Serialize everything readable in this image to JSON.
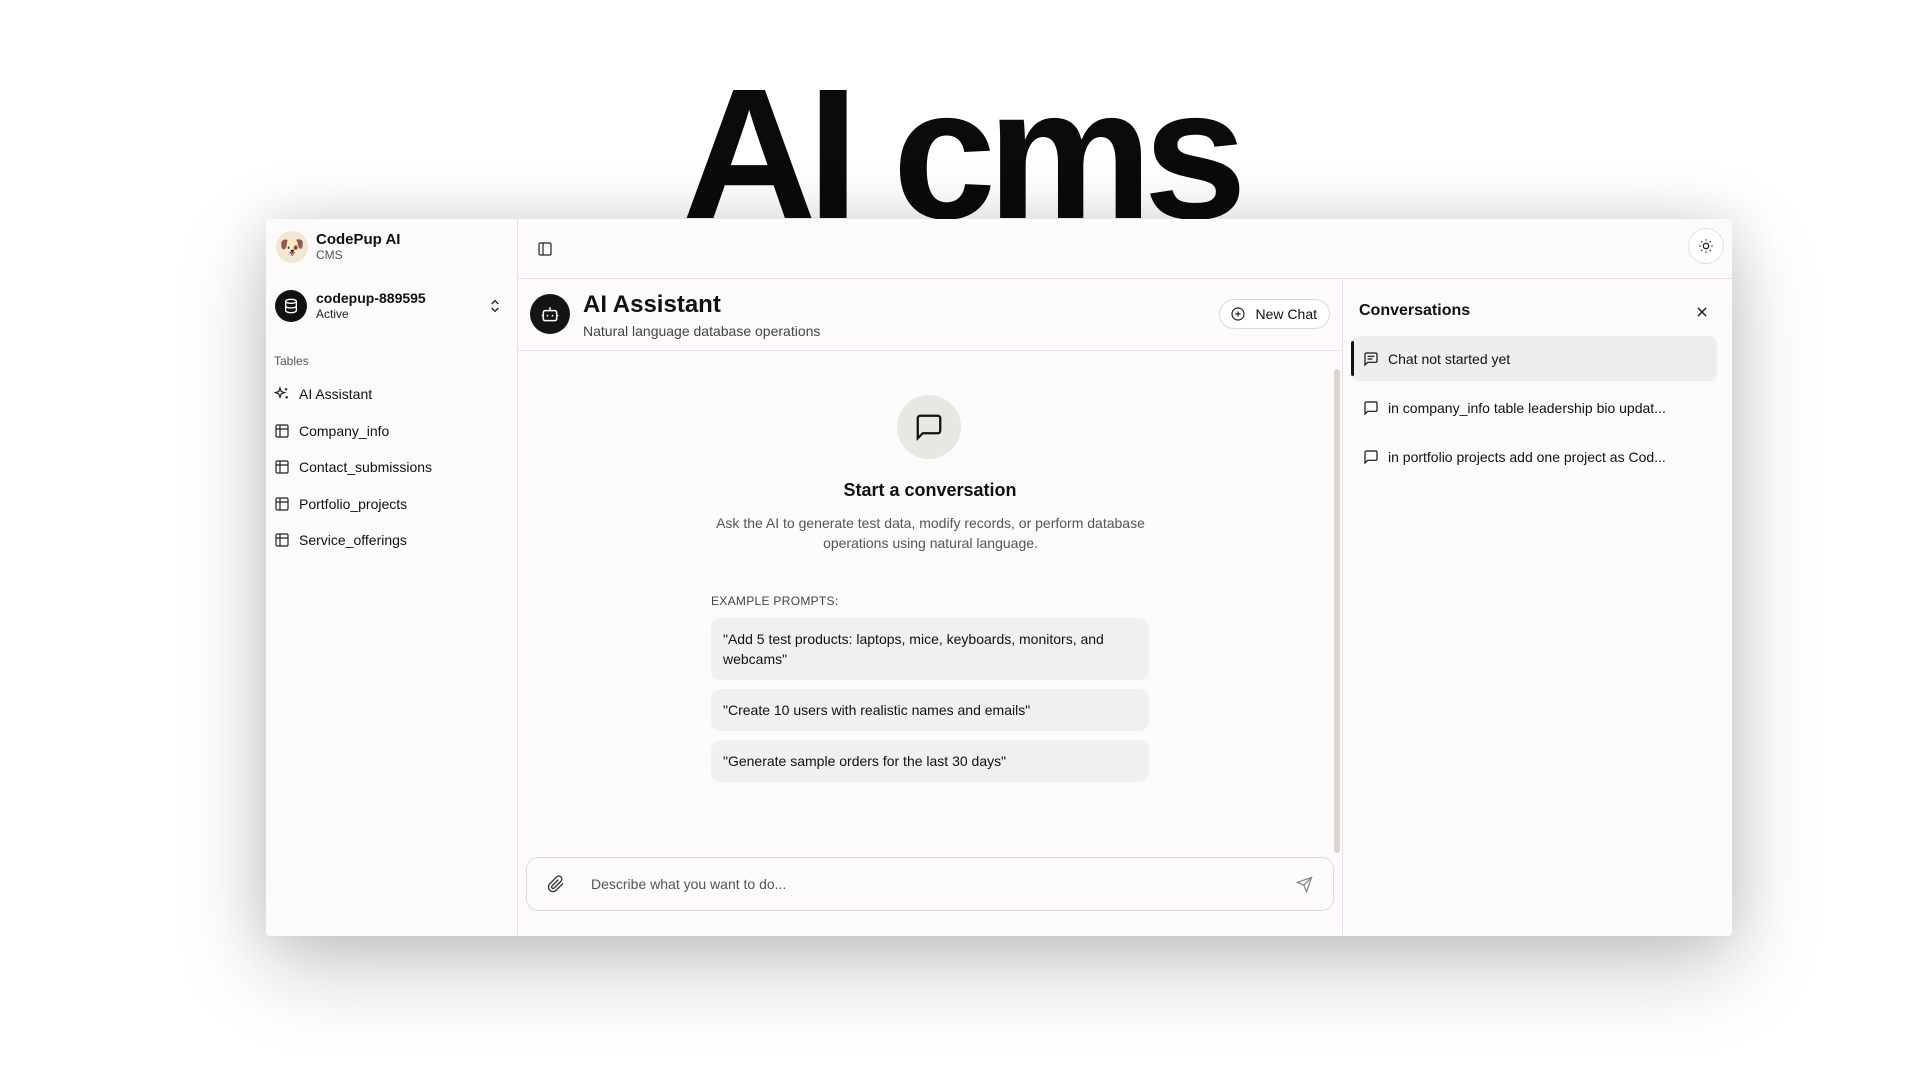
{
  "hero": {
    "title": "AI cms"
  },
  "brand": {
    "name": "CodePup AI",
    "subtitle": "CMS"
  },
  "database": {
    "name": "codepup-889595",
    "status": "Active"
  },
  "sidebar": {
    "section_label": "Tables",
    "items": [
      {
        "label": "AI Assistant",
        "icon": "sparkles-icon"
      },
      {
        "label": "Company_info",
        "icon": "table-icon"
      },
      {
        "label": "Contact_submissions",
        "icon": "table-icon"
      },
      {
        "label": "Portfolio_projects",
        "icon": "table-icon"
      },
      {
        "label": "Service_offerings",
        "icon": "table-icon"
      }
    ]
  },
  "chat": {
    "title": "AI Assistant",
    "subtitle": "Natural language database operations",
    "new_chat_label": "New Chat",
    "empty_title": "Start a conversation",
    "empty_description": "Ask the AI to generate test data, modify records, or perform database operations using natural language.",
    "examples_label": "EXAMPLE PROMPTS:",
    "examples": [
      "\"Add 5 test products: laptops, mice, keyboards, monitors, and webcams\"",
      "\"Create 10 users with realistic names and emails\"",
      "\"Generate sample orders for the last 30 days\""
    ],
    "input_placeholder": "Describe what you want to do..."
  },
  "conversations": {
    "title": "Conversations",
    "items": [
      {
        "label": "Chat not started yet",
        "active": true
      },
      {
        "label": "in company_info table leadership bio updat...",
        "active": false
      },
      {
        "label": "in portfolio projects add one project as Cod...",
        "active": false
      }
    ]
  }
}
